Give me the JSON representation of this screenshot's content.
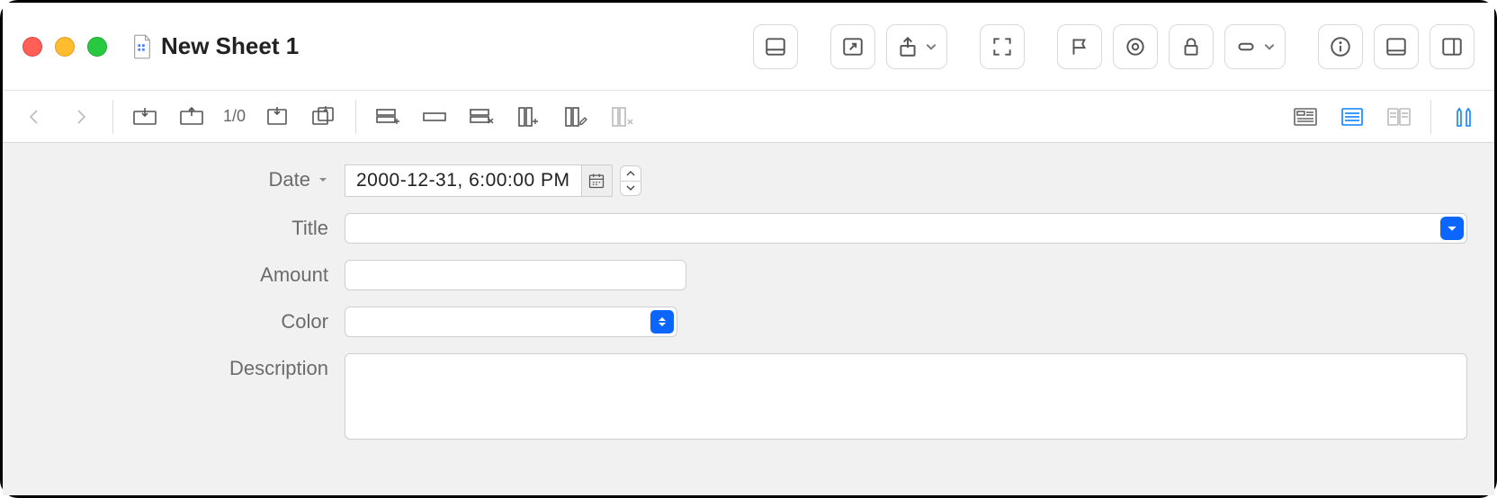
{
  "window": {
    "title": "New Sheet 1"
  },
  "toolbar": {
    "record_counter": "1/0"
  },
  "form": {
    "date": {
      "label": "Date",
      "value": "2000-12-31,  6:00:00 PM"
    },
    "title": {
      "label": "Title",
      "value": ""
    },
    "amount": {
      "label": "Amount",
      "value": ""
    },
    "color": {
      "label": "Color",
      "value": ""
    },
    "description": {
      "label": "Description",
      "value": ""
    }
  }
}
